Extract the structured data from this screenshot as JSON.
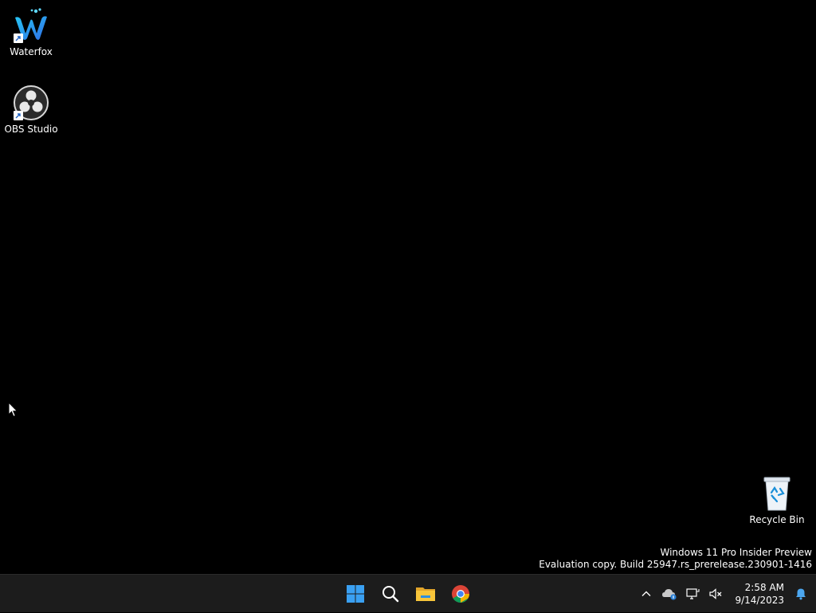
{
  "desktop": {
    "icons": [
      {
        "label": "Waterfox",
        "icon": "waterfox-icon",
        "shortcut": true
      },
      {
        "label": "OBS Studio",
        "icon": "obs-studio-icon",
        "shortcut": true
      },
      {
        "label": "Recycle Bin",
        "icon": "recycle-bin-icon",
        "shortcut": false
      }
    ],
    "background": "#000000"
  },
  "watermark": {
    "line1": "Windows 11 Pro Insider Preview",
    "line2": "Evaluation copy. Build 25947.rs_prerelease.230901-1416"
  },
  "taskbar": {
    "pinned": [
      {
        "name": "Start",
        "icon": "windows-start-icon"
      },
      {
        "name": "Search",
        "icon": "search-icon"
      },
      {
        "name": "File Explorer",
        "icon": "file-explorer-icon"
      },
      {
        "name": "Google Chrome",
        "icon": "chrome-icon"
      }
    ],
    "tray": {
      "icons": [
        "chevron-up-icon",
        "onedrive-icon",
        "network-icon",
        "volume-muted-icon",
        "notification-bell-icon"
      ],
      "time": "2:58 AM",
      "date": "9/14/2023"
    },
    "accent": "#1c1c1c"
  }
}
